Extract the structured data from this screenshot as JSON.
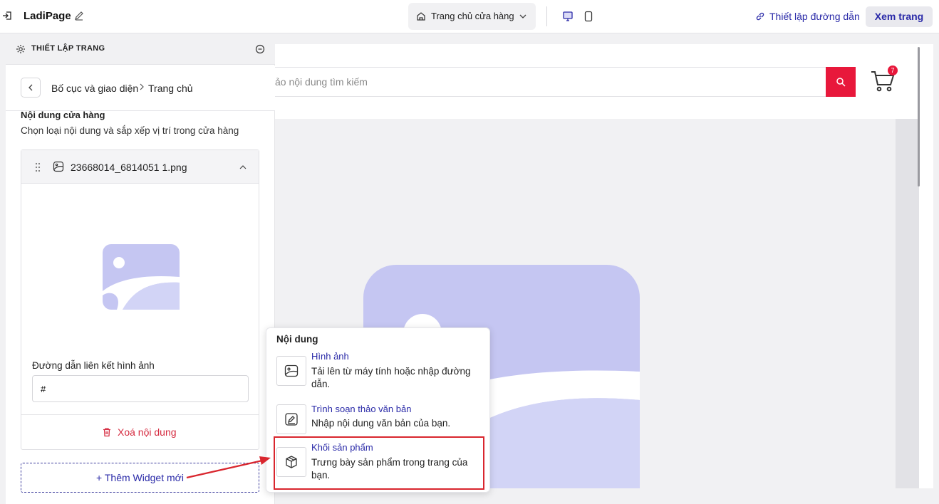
{
  "topbar": {
    "app_title": "LadiPage",
    "page_select": "Trang chủ cửa hàng",
    "link_setup": "Thiết lập đường dẫn",
    "view_page": "Xem trang"
  },
  "canvas": {
    "search_placeholder": "ảo nội dung tìm kiếm",
    "cart_count": "7"
  },
  "panel": {
    "title": "THIẾT LẬP TRANG",
    "breadcrumb": [
      "Bố cục và giao diện",
      "Trang chủ"
    ],
    "section_title": "Nội dung cửa hàng",
    "section_desc": "Chọn loại nội dung và sắp xếp vị trí trong cửa hàng",
    "widget": {
      "name": "23668014_6814051 1.png",
      "link_label": "Đường dẫn liên kết hình ảnh",
      "link_value": "#",
      "delete_label": "Xoá nội dung"
    },
    "add_widget": "+ Thêm Widget mới"
  },
  "popup": {
    "title": "Nội dung",
    "options": [
      {
        "title": "Hình ảnh",
        "desc": "Tải lên từ máy tính hoặc nhập đường dẫn.",
        "icon": "image-icon"
      },
      {
        "title": "Trình soạn thảo văn bản",
        "desc": "Nhập nội dung văn bản của bạn.",
        "icon": "text-editor-icon"
      },
      {
        "title": "Khối sản phẩm",
        "desc": "Trưng bày sản phẩm trong trang của bạn.",
        "icon": "box-icon"
      }
    ]
  },
  "colors": {
    "accent": "#2a2aa8",
    "danger": "#e8183b",
    "placeholder_fill": "#c5c6f2",
    "highlight": "#d9262e"
  }
}
